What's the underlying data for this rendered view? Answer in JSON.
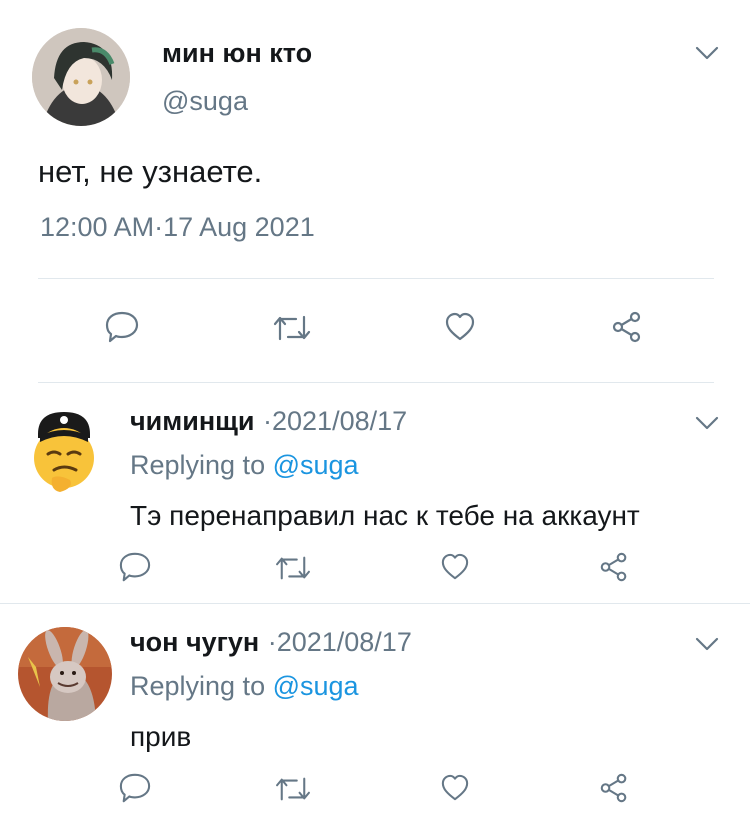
{
  "main_tweet": {
    "author": {
      "name": "мин юн кто",
      "handle": "@suga"
    },
    "text": "нет, не узнаете.",
    "time": "12:00 AM",
    "date_sep": "·",
    "date": "17 Aug 2021"
  },
  "replies": [
    {
      "author": {
        "name": "чиминщи"
      },
      "date_prefix": "·",
      "date": "2021/08/17",
      "replying_label": "Replying to",
      "replying_handle": "@suga",
      "text": "Тэ перенаправил нас к тебе на аккаунт"
    },
    {
      "author": {
        "name": "чон чугун"
      },
      "date_prefix": "·",
      "date": "2021/08/17",
      "replying_label": "Replying to",
      "replying_handle": "@suga",
      "text": "прив"
    }
  ],
  "colors": {
    "text": "#14171a",
    "secondary": "#657786",
    "link": "#1b95e0",
    "separator": "#e1e8ed"
  },
  "icons": [
    "chevron-down-icon",
    "reply-icon",
    "retweet-icon",
    "like-icon",
    "share-icon"
  ]
}
